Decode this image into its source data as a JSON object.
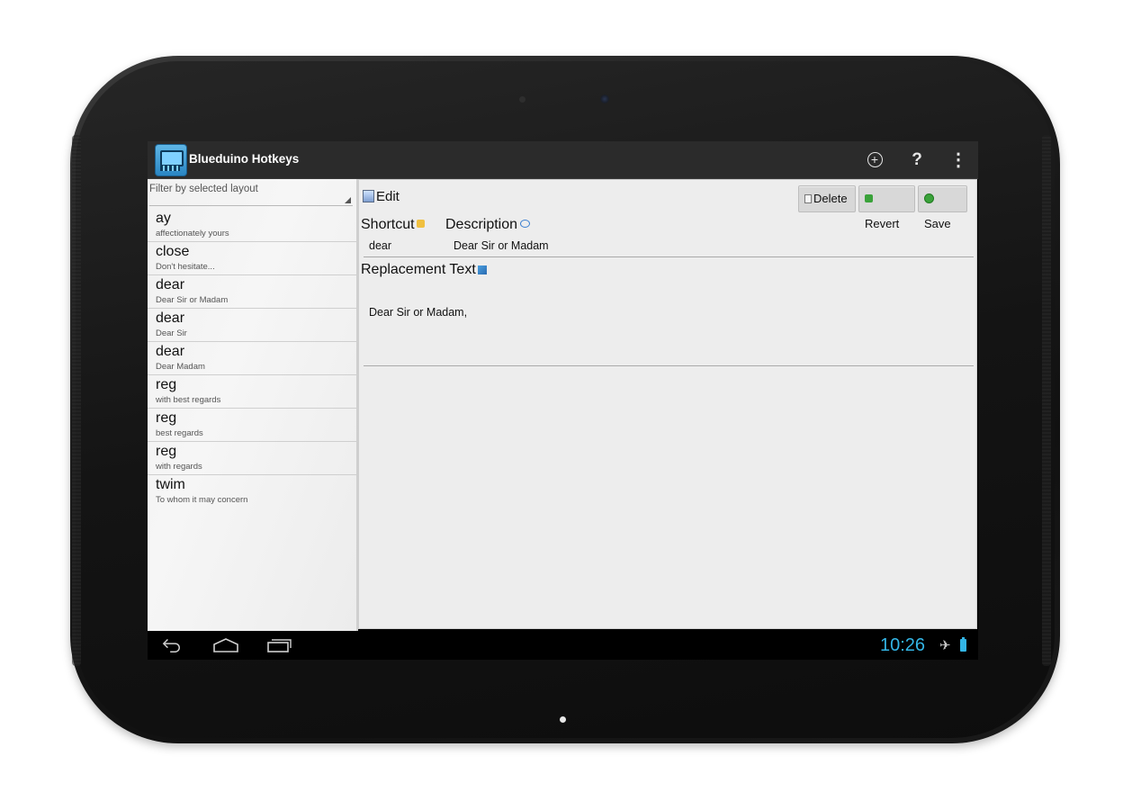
{
  "app": {
    "title": "Blueduino Hotkeys",
    "icon": "keyboard-app-icon"
  },
  "actionbar": {
    "add_icon": "add-circle-icon",
    "help_label": "?",
    "more_label": "⋮"
  },
  "filter": {
    "label": "Filter by selected layout"
  },
  "list": [
    {
      "key": "ay",
      "desc": "affectionately yours"
    },
    {
      "key": "close",
      "desc": "Don't hesitate..."
    },
    {
      "key": "dear",
      "desc": "Dear Sir or Madam"
    },
    {
      "key": "dear",
      "desc": "Dear Sir"
    },
    {
      "key": "dear",
      "desc": "Dear Madam"
    },
    {
      "key": "reg",
      "desc": "with best regards"
    },
    {
      "key": "reg",
      "desc": "best regards"
    },
    {
      "key": "reg",
      "desc": "with regards"
    },
    {
      "key": "twim",
      "desc": "To whom it may concern"
    }
  ],
  "edit": {
    "heading": "Edit",
    "delete_label": "Delete",
    "revert_label": "Revert",
    "save_label": "Save",
    "shortcut_label": "Shortcut",
    "description_label": "Description",
    "replacement_label": "Replacement Text",
    "shortcut_value": "dear",
    "description_value": "Dear Sir or Madam",
    "replacement_value": "Dear Sir or Madam,"
  },
  "status": {
    "time": "10:26",
    "airplane_icon": "airplane-icon",
    "battery_icon": "battery-icon"
  },
  "colors": {
    "accent": "#33b5e5",
    "actionbar": "#2b2b2b",
    "panel_bg": "#ededed"
  }
}
